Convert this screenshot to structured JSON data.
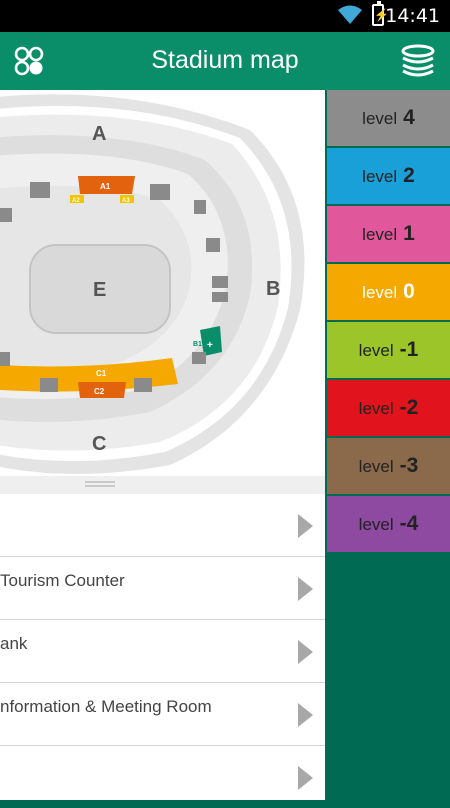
{
  "status_bar": {
    "time": "14:41"
  },
  "header": {
    "title": "Stadium map",
    "menu_icon": "apps-grid-icon",
    "levels_icon": "stack-layers-icon"
  },
  "map": {
    "sections": {
      "a": "A",
      "b": "B",
      "c": "C",
      "e": "E"
    },
    "stands": {
      "a1": "A1",
      "a2": "A2",
      "a3": "A3",
      "c1": "C1",
      "c2": "C2",
      "b1": "B1"
    }
  },
  "levels": [
    {
      "word": "level",
      "num": "4",
      "color": "#8c8c8c",
      "selected": false
    },
    {
      "word": "level",
      "num": "2",
      "color": "#1aa0d8",
      "selected": false
    },
    {
      "word": "level",
      "num": "1",
      "color": "#e0579c",
      "selected": false
    },
    {
      "word": "level",
      "num": "0",
      "color": "#f5a800",
      "selected": true
    },
    {
      "word": "level",
      "num": "-1",
      "color": "#9cc52a",
      "selected": false
    },
    {
      "word": "level",
      "num": "-2",
      "color": "#e1141d",
      "selected": false
    },
    {
      "word": "level",
      "num": "-3",
      "color": "#8b6a4b",
      "selected": false
    },
    {
      "word": "level",
      "num": "-4",
      "color": "#8d4aa0",
      "selected": false
    }
  ],
  "list_items": [
    {
      "label": ""
    },
    {
      "label": "Tourism Counter"
    },
    {
      "label": "ank"
    },
    {
      "label": "nformation & Meeting Room"
    },
    {
      "label": ""
    }
  ],
  "colors": {
    "brand": "#0a8e6a",
    "sidebar_bg": "#006b52",
    "stand_orange": "#f5a800",
    "stand_dark_orange": "#e2620e"
  }
}
